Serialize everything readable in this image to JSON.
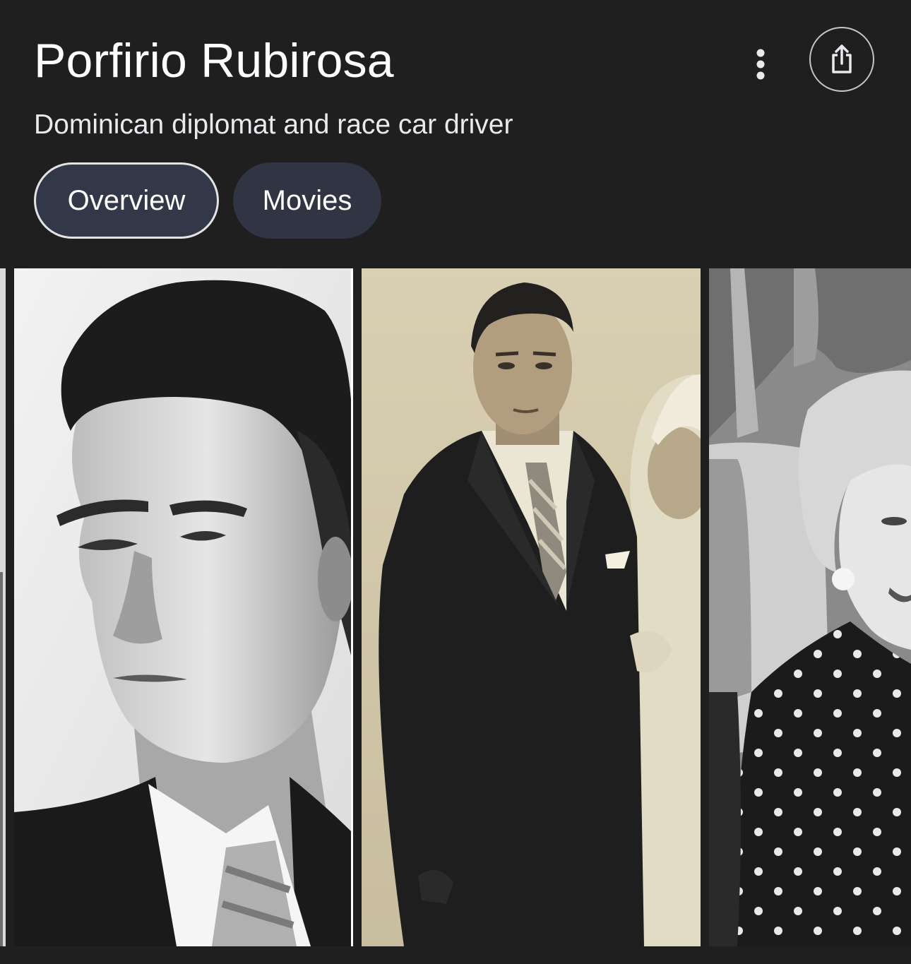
{
  "entity": {
    "title": "Porfirio Rubirosa",
    "subtitle": "Dominican diplomat and race car driver"
  },
  "header_actions": {
    "more_icon": "more-vert-icon",
    "share_icon": "share-icon"
  },
  "tabs": [
    {
      "label": "Overview",
      "selected": true
    },
    {
      "label": "Movies",
      "selected": false
    }
  ],
  "gallery": {
    "images": [
      {
        "description_icon": "photo-partial"
      },
      {
        "description_icon": "photo-portrait-man-profile"
      },
      {
        "description_icon": "photo-man-in-suit-sepia"
      },
      {
        "description_icon": "photo-woman-polka-dot-dress"
      }
    ]
  },
  "colors": {
    "background": "#1f1f1f",
    "chip_background": "#303443",
    "chip_selected_border": "#e3e3e3",
    "text_primary": "#ffffff"
  }
}
